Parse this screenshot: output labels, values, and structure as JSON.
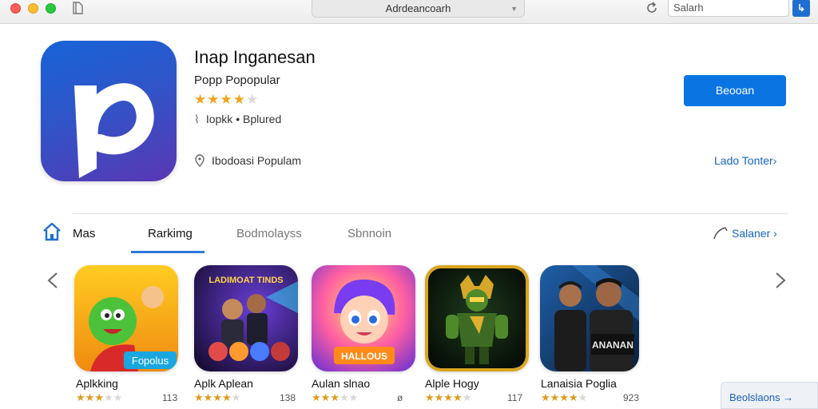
{
  "browser": {
    "address": "Adrdeancoarh",
    "search_placeholder": "Salarh",
    "search_button_glyph": "↳"
  },
  "app": {
    "title": "Inap Inganesan",
    "subtitle": "Popp Popopular",
    "rating_stars": 4,
    "developer": "Iopkk • Bplured",
    "category": "Ibodoasi Populam",
    "get_label": "Beooan",
    "side_link": "Lado Tonter›",
    "icon_name": "app-logo-icon",
    "brand_color": "#1764d8"
  },
  "tabs": {
    "items": [
      {
        "label": "Mas"
      },
      {
        "label": "Rarkimg"
      },
      {
        "label": "Bodmolayss"
      },
      {
        "label": "Sbnnoin"
      }
    ],
    "active_index": 1,
    "see_all": "Salaner ›"
  },
  "carousel": {
    "items": [
      {
        "name": "Aplkking",
        "stars": 3,
        "count": "113"
      },
      {
        "name": "Aplk Aplean",
        "stars": 4,
        "count": "138"
      },
      {
        "name": "Aulan slnao",
        "stars": 3,
        "count": "ø"
      },
      {
        "name": "Alple Hogy",
        "stars": 4,
        "count": "117"
      },
      {
        "name": "Lanaisia Poglia",
        "stars": 4,
        "count": "923"
      }
    ],
    "art_text": {
      "card1": "Fopolus",
      "card2": "LADIMOAT TINDS",
      "card3": "HALLOUS",
      "card5": "ANANAN"
    }
  },
  "footer_button": "Beolslaons →"
}
